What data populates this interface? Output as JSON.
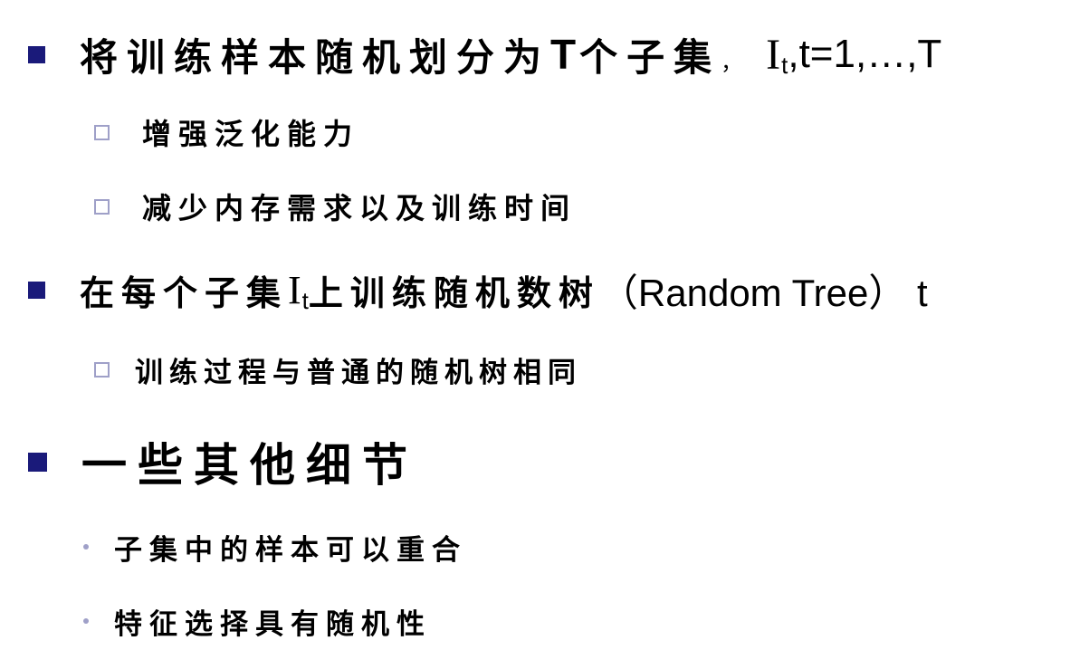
{
  "colors": {
    "level1_bullet": "#1a1a7a",
    "level2_bullet": "#9fa0c8",
    "text": "#000000",
    "background": "#ffffff"
  },
  "items": [
    {
      "level": 1,
      "bullet": "filled-square",
      "text_cjk": "将训练样本随机划分为",
      "text_T": "T",
      "text_cjk2": "个子集",
      "comma": "，",
      "var": "I",
      "sub": "t",
      "text_tail": ",t=1,…,T"
    },
    {
      "level": 2,
      "bullet": "hollow-square",
      "text": "增强泛化能力"
    },
    {
      "level": 2,
      "bullet": "hollow-square",
      "text": "减少内存需求以及训练时间"
    },
    {
      "level": 1,
      "bullet": "filled-square",
      "text_cjk": "在每个子集",
      "var": "I",
      "sub": "t",
      "text_cjk2": "上训练随机数树",
      "text_tail": "（Random Tree） t"
    },
    {
      "level": 2,
      "bullet": "hollow-square",
      "text": "训练过程与普通的随机树相同"
    },
    {
      "level": 1,
      "bullet": "filled-square",
      "text": "一些其他细节"
    },
    {
      "level": 3,
      "bullet": "dot",
      "text": "子集中的样本可以重合"
    },
    {
      "level": 3,
      "bullet": "dot",
      "text": "特征选择具有随机性"
    }
  ]
}
